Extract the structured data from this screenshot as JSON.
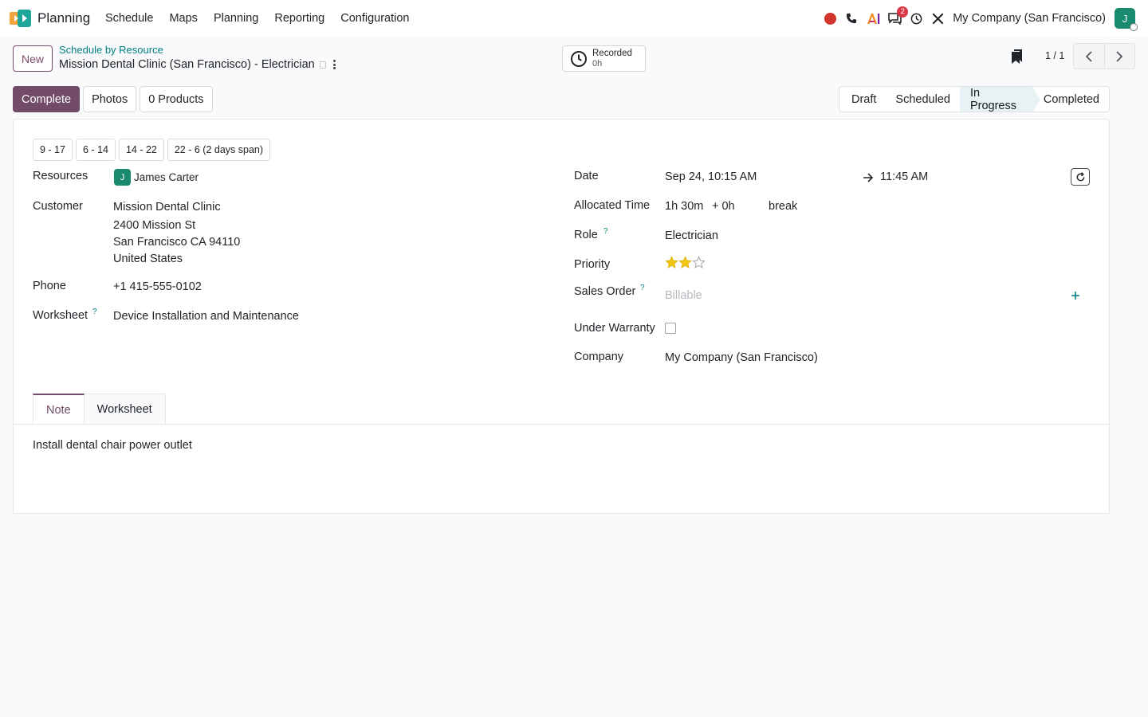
{
  "colors": {
    "brand": "#714b67",
    "link": "#017e84",
    "avatar": "#1a8a6e",
    "record": "#d0342c",
    "badge": "#dc3545"
  },
  "navbar": {
    "app_name": "Planning",
    "menu": [
      "Schedule",
      "Maps",
      "Planning",
      "Reporting",
      "Configuration"
    ],
    "company": "My Company (San Francisco)",
    "avatar_initial": "J",
    "messages_badge": "2",
    "icons": [
      "record-icon",
      "phone-icon",
      "ai-icon",
      "messages-icon",
      "clock-icon",
      "tools-icon"
    ]
  },
  "control": {
    "new_label": "New",
    "breadcrumb": "Schedule by Resource",
    "record_title": "Mission Dental Clinic (San Francisco) - Electrician",
    "timer_label": "Recorded",
    "timer_value": "0h",
    "pager": "1 / 1"
  },
  "actions": [
    "Complete",
    "Photos",
    "0 Products"
  ],
  "status": {
    "stages": [
      "Draft",
      "Scheduled",
      "In Progress",
      "Completed"
    ],
    "current": "In Progress"
  },
  "shifts": [
    "9 - 17",
    "6 - 14",
    "14 - 22",
    "22 - 6 (2 days span)"
  ],
  "form": {
    "resources_label": "Resources",
    "resource_initial": "J",
    "resource_name": "James Carter",
    "customer_label": "Customer",
    "customer_name": "Mission Dental Clinic",
    "customer_street": "2400 Mission St",
    "customer_city": "San Francisco CA 94110",
    "customer_country": "United States",
    "phone_label": "Phone",
    "phone": "+1 415-555-0102",
    "worksheet_label": "Worksheet",
    "worksheet": "Device Installation and Maintenance",
    "date_label": "Date",
    "date_start": "Sep 24, 10:15 AM",
    "date_end": "11:45 AM",
    "allocated_label": "Allocated Time",
    "allocated": "1h 30m",
    "allocated_extra": "+ 0h",
    "break_label": "break",
    "role_label": "Role",
    "role": "Electrician",
    "priority_label": "Priority",
    "priority_stars": 2,
    "priority_max": 3,
    "sales_order_label": "Sales Order",
    "sales_order_placeholder": "Billable",
    "warranty_label": "Under Warranty",
    "company_label": "Company",
    "company": "My Company (San Francisco)",
    "help_mark": "?"
  },
  "tabs": [
    "Note",
    "Worksheet"
  ],
  "note": "Install dental chair power outlet"
}
